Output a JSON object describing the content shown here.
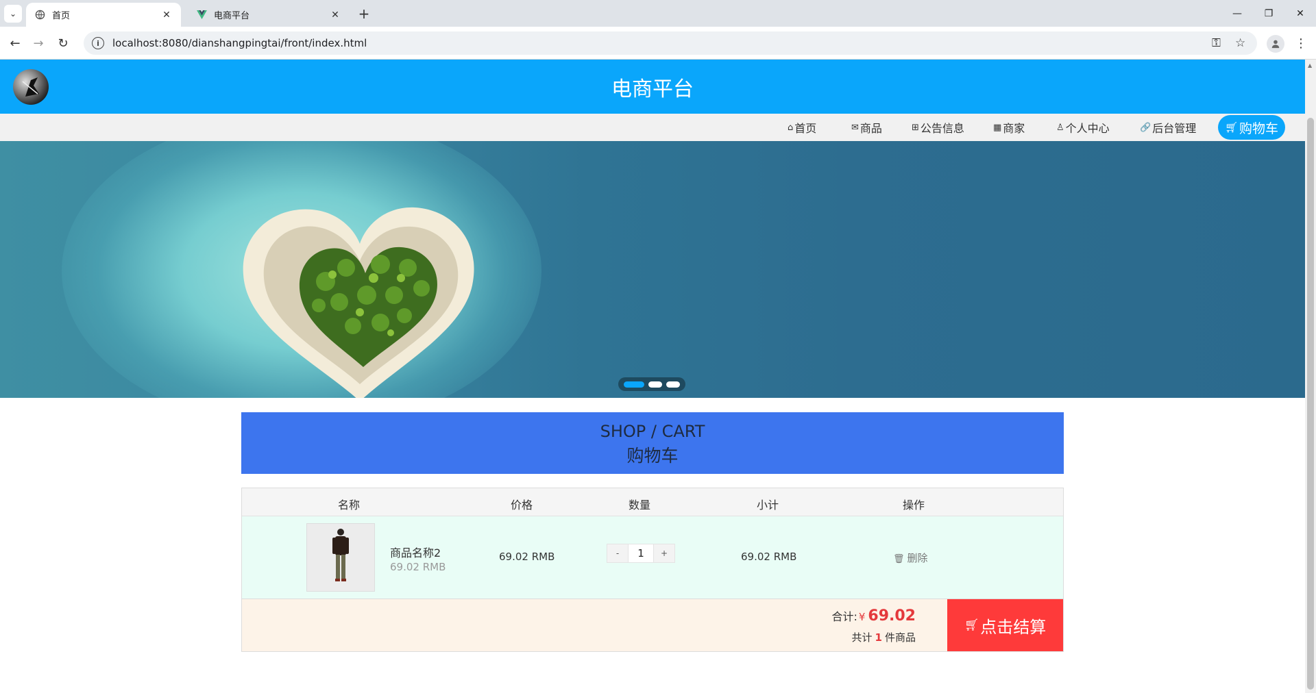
{
  "browser": {
    "tabs": [
      {
        "title": "首页",
        "active": true
      },
      {
        "title": "电商平台",
        "active": false
      }
    ],
    "url": "localhost:8080/dianshangpingtai/front/index.html"
  },
  "site": {
    "title": "电商平台",
    "nav": [
      {
        "icon": "home-icon",
        "label": "首页"
      },
      {
        "icon": "mail-icon",
        "label": "商品"
      },
      {
        "icon": "gift-icon",
        "label": "公告信息"
      },
      {
        "icon": "calendar-icon",
        "label": "商家"
      },
      {
        "icon": "user-icon",
        "label": "个人中心"
      },
      {
        "icon": "link-icon",
        "label": "后台管理"
      },
      {
        "icon": "cart-icon",
        "label": "购物车",
        "active": true
      }
    ],
    "accent_color": "#0aa6fb"
  },
  "banner": {
    "slides": 3,
    "active_slide": 1
  },
  "cart_section": {
    "title_en": "SHOP / CART",
    "title_cn": "购物车"
  },
  "cart": {
    "headers": {
      "name": "名称",
      "price": "价格",
      "qty": "数量",
      "subtotal": "小计",
      "ops": "操作"
    },
    "items": [
      {
        "name": "商品名称2",
        "unit_price_label": "69.02 RMB",
        "price": "69.02 RMB",
        "qty": "1",
        "subtotal": "69.02 RMB",
        "delete_label": "删除"
      }
    ],
    "qty_minus": "-",
    "qty_plus": "+",
    "total_label": "合计:",
    "currency": "¥",
    "total": "69.02",
    "count_prefix": "共计",
    "count": "1",
    "count_suffix": "件商品",
    "checkout_label": "点击结算"
  }
}
